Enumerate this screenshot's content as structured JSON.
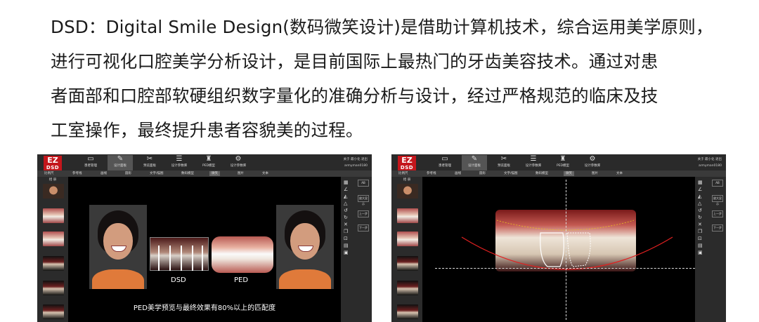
{
  "paragraph": {
    "lines": [
      "DSD：Digital Smile Design(数码微笑设计)是借助计算机技术，综合运用美学原则，",
      "进行可视化口腔美学分析设计，是目前国际上最热门的牙齿美容技术。通过对患",
      "者面部和口腔部软硬组织数字量化的准确分析与设计，经过严格规范的临床及技",
      "工室操作，最终提升患者容貌美的过程。"
    ]
  },
  "app": {
    "logo_top": "EZ",
    "logo_bottom": "DSD",
    "nav": [
      {
        "label": "患者管理",
        "icon": "folder-icon"
      },
      {
        "label": "设计面板",
        "icon": "edit-icon"
      },
      {
        "label": "预览面板",
        "icon": "tools-icon"
      },
      {
        "label": "设计参数库",
        "icon": "library-icon"
      },
      {
        "label": "PED模型",
        "icon": "tooth-icon"
      },
      {
        "label": "设计参数库",
        "icon": "settings-icon"
      }
    ],
    "user_links": "关于  最小化  退出",
    "username": "armyman0180",
    "tools": [
      "比例尺",
      "参考线",
      "画线",
      "圆形",
      "文字/描图",
      "数码模型",
      "微笑",
      "图片",
      "文本"
    ],
    "left_panel_title": "相 册",
    "right_tools": [
      "AB",
      "放大显示",
      "上一步",
      "下一步"
    ]
  },
  "screenshot1": {
    "label_dsd": "DSD",
    "label_ped": "PED",
    "caption": "PED美学预览与最终效果有80%以上的匹配度"
  },
  "colors": {
    "logo_red": "#c4161c",
    "toolbar": "#2a2a2a",
    "arc_red": "#e02020",
    "guide_yellow": "#e8c020"
  }
}
